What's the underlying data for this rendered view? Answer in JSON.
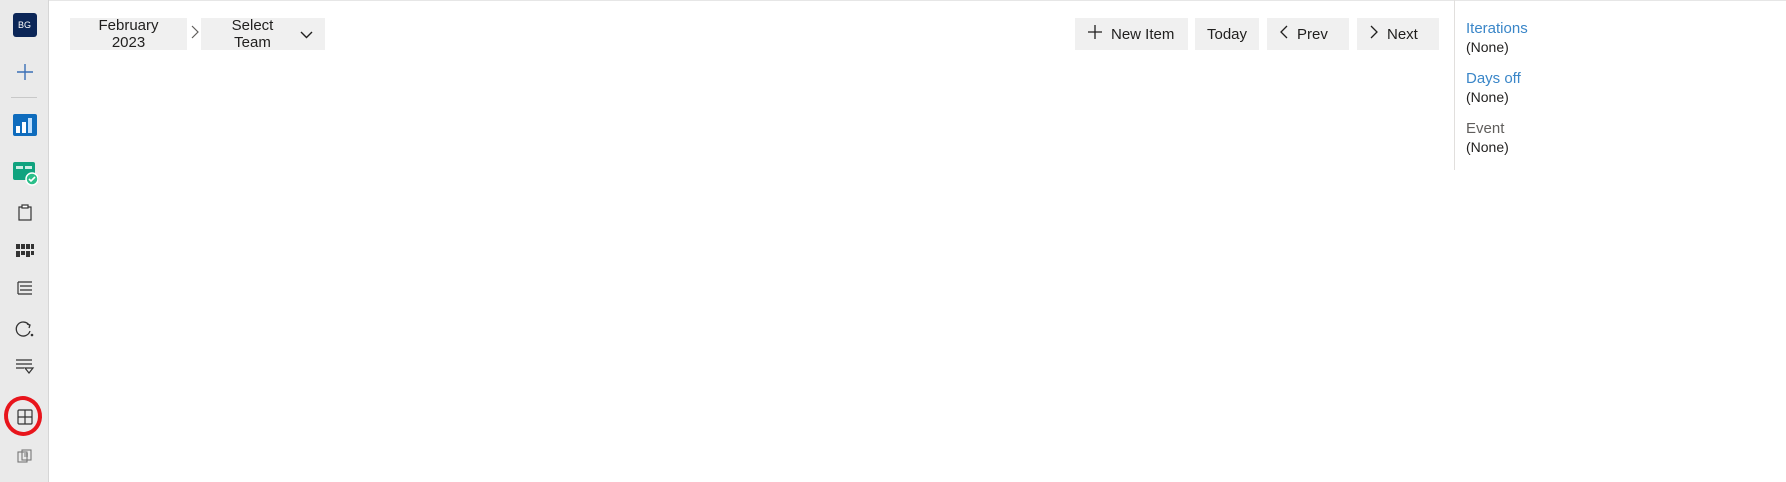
{
  "rail": {
    "avatar_initials": "BG",
    "icons": [
      "add-icon",
      "boards-icon",
      "plans-icon",
      "work-items-icon",
      "backlogs-icon",
      "sprints-icon",
      "queries-icon",
      "delivery-plans-icon",
      "calendar-grid-icon",
      "retrospectives-icon"
    ]
  },
  "toolbar": {
    "month_label": "February 2023",
    "team_label": "Select Team",
    "new_item_label": "New Item",
    "today_label": "Today",
    "prev_label": "Prev",
    "next_label": "Next"
  },
  "panel": {
    "iterations_label": "Iterations",
    "iterations_value": "(None)",
    "days_off_label": "Days off",
    "days_off_value": "(None)",
    "event_label": "Event",
    "event_value": "(None)"
  },
  "colors": {
    "link": "#3a86c8",
    "annotation": "#e8151c",
    "avatar_bg": "#0b2657"
  }
}
